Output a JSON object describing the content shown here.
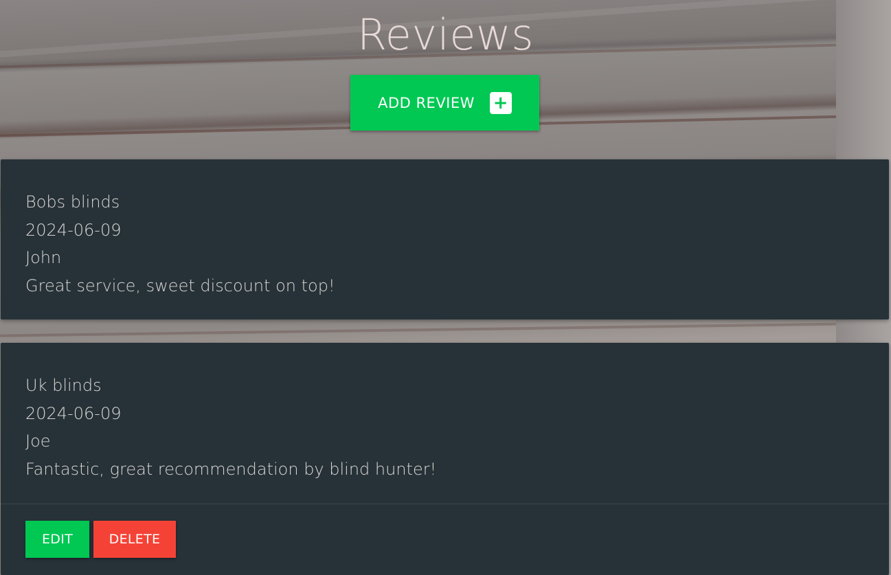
{
  "page": {
    "title": "Reviews"
  },
  "actions": {
    "add_review_label": "ADD REVIEW",
    "add_icon": "+"
  },
  "reviews": [
    {
      "company": "Bobs blinds",
      "date": "2024-06-09",
      "author": "John",
      "text": "Great service, sweet discount on top!"
    },
    {
      "company": "Uk blinds",
      "date": "2024-06-09",
      "author": "Joe",
      "text": "Fantastic, great recommendation by blind hunter!",
      "edit_label": "EDIT",
      "delete_label": "DELETE"
    }
  ],
  "colors": {
    "accent_green": "#00c853",
    "danger_red": "#f44336",
    "card_bg": "#263238"
  }
}
